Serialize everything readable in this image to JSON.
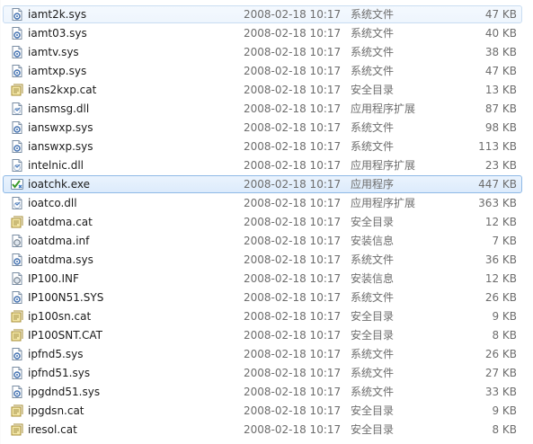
{
  "files": [
    {
      "name": "iamt2k.sys",
      "date": "2008-02-18 10:17",
      "type": "系统文件",
      "size": "47 KB",
      "icon": "system-file-icon",
      "state": "hover"
    },
    {
      "name": "iamt03.sys",
      "date": "2008-02-18 10:17",
      "type": "系统文件",
      "size": "40 KB",
      "icon": "system-file-icon"
    },
    {
      "name": "iamtv.sys",
      "date": "2008-02-18 10:17",
      "type": "系统文件",
      "size": "38 KB",
      "icon": "system-file-icon"
    },
    {
      "name": "iamtxp.sys",
      "date": "2008-02-18 10:17",
      "type": "系统文件",
      "size": "47 KB",
      "icon": "system-file-icon"
    },
    {
      "name": "ians2kxp.cat",
      "date": "2008-02-18 10:17",
      "type": "安全目录",
      "size": "13 KB",
      "icon": "security-catalog-icon"
    },
    {
      "name": "iansmsg.dll",
      "date": "2008-02-18 10:17",
      "type": "应用程序扩展",
      "size": "87 KB",
      "icon": "dll-file-icon"
    },
    {
      "name": "ianswxp.sys",
      "date": "2008-02-18 10:17",
      "type": "系统文件",
      "size": "98 KB",
      "icon": "system-file-icon"
    },
    {
      "name": "ianswxp.sys",
      "date": "2008-02-18 10:17",
      "type": "系统文件",
      "size": "113 KB",
      "icon": "system-file-icon"
    },
    {
      "name": "intelnic.dll",
      "date": "2008-02-18 10:17",
      "type": "应用程序扩展",
      "size": "23 KB",
      "icon": "dll-file-icon"
    },
    {
      "name": "ioatchk.exe",
      "date": "2008-02-18 10:17",
      "type": "应用程序",
      "size": "447 KB",
      "icon": "executable-icon",
      "state": "selected"
    },
    {
      "name": "ioatco.dll",
      "date": "2008-02-18 10:17",
      "type": "应用程序扩展",
      "size": "363 KB",
      "icon": "dll-file-icon"
    },
    {
      "name": "ioatdma.cat",
      "date": "2008-02-18 10:17",
      "type": "安全目录",
      "size": "12 KB",
      "icon": "security-catalog-icon"
    },
    {
      "name": "ioatdma.inf",
      "date": "2008-02-18 10:17",
      "type": "安装信息",
      "size": "7 KB",
      "icon": "setup-info-icon"
    },
    {
      "name": "ioatdma.sys",
      "date": "2008-02-18 10:17",
      "type": "系统文件",
      "size": "36 KB",
      "icon": "system-file-icon"
    },
    {
      "name": "IP100.INF",
      "date": "2008-02-18 10:17",
      "type": "安装信息",
      "size": "12 KB",
      "icon": "setup-info-icon"
    },
    {
      "name": "IP100N51.SYS",
      "date": "2008-02-18 10:17",
      "type": "系统文件",
      "size": "26 KB",
      "icon": "system-file-icon"
    },
    {
      "name": "ip100sn.cat",
      "date": "2008-02-18 10:17",
      "type": "安全目录",
      "size": "9 KB",
      "icon": "security-catalog-icon"
    },
    {
      "name": "IP100SNT.CAT",
      "date": "2008-02-18 10:17",
      "type": "安全目录",
      "size": "8 KB",
      "icon": "security-catalog-icon"
    },
    {
      "name": "ipfnd5.sys",
      "date": "2008-02-18 10:17",
      "type": "系统文件",
      "size": "26 KB",
      "icon": "system-file-icon"
    },
    {
      "name": "ipfnd51.sys",
      "date": "2008-02-18 10:17",
      "type": "系统文件",
      "size": "27 KB",
      "icon": "system-file-icon"
    },
    {
      "name": "ipgdnd51.sys",
      "date": "2008-02-18 10:17",
      "type": "系统文件",
      "size": "33 KB",
      "icon": "system-file-icon"
    },
    {
      "name": "ipgdsn.cat",
      "date": "2008-02-18 10:17",
      "type": "安全目录",
      "size": "9 KB",
      "icon": "security-catalog-icon"
    },
    {
      "name": "iresol.cat",
      "date": "2008-02-18 10:17",
      "type": "安全目录",
      "size": "8 KB",
      "icon": "security-catalog-icon"
    }
  ]
}
